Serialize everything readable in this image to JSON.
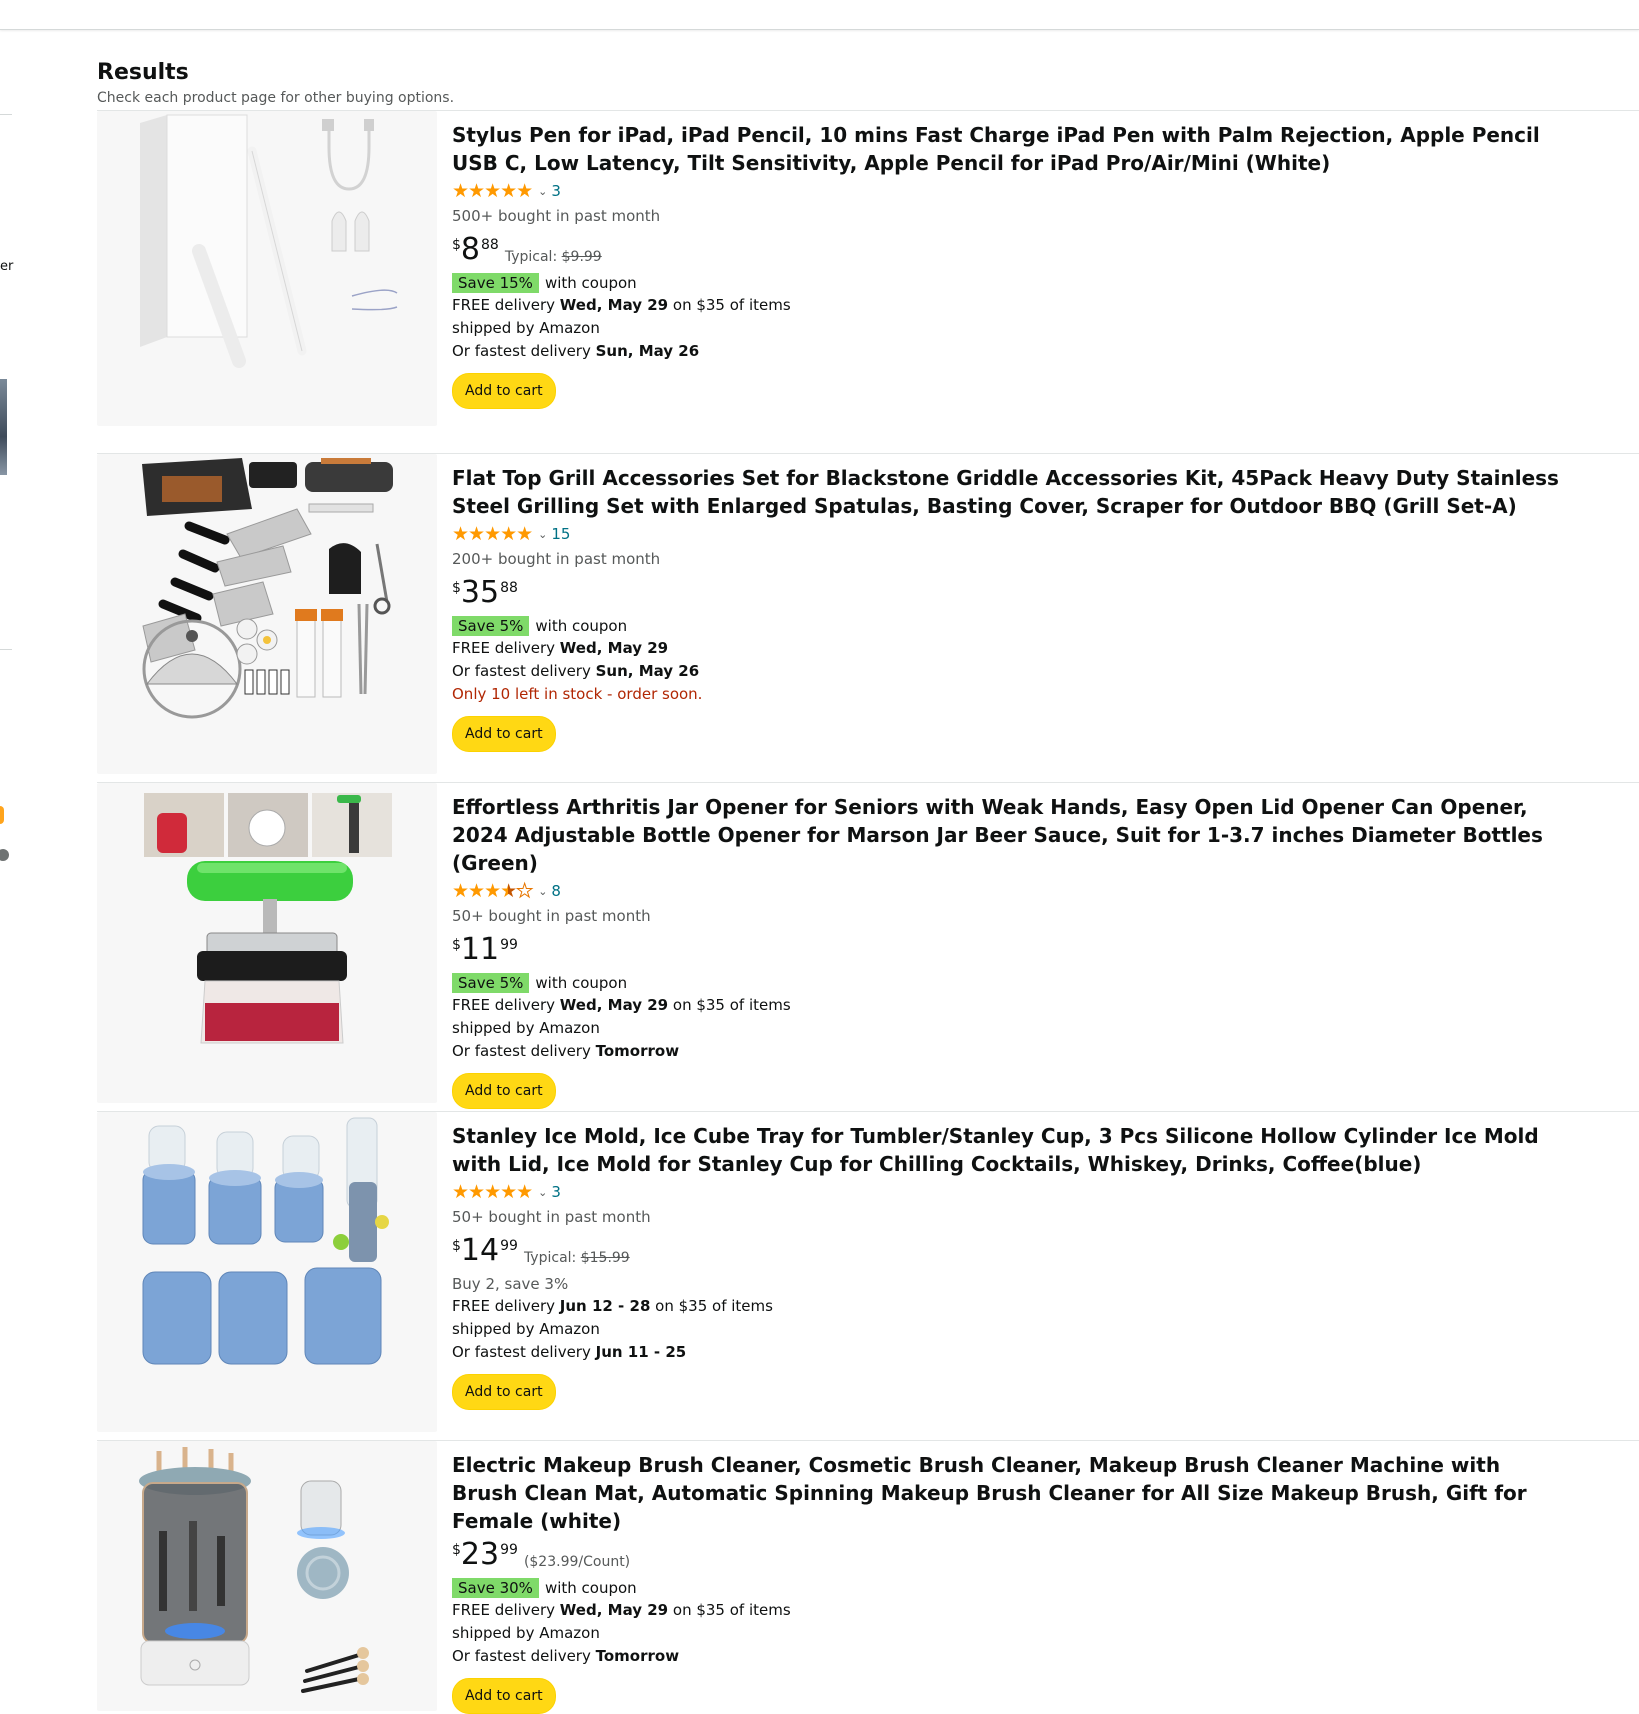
{
  "results": {
    "title": "Results",
    "subtitle": "Check each product page for other buying options."
  },
  "left_strip": {
    "partial_text": "er"
  },
  "colors": {
    "star": "#ff9900",
    "coupon_bg": "#7fda69",
    "button_bg": "#ffd814",
    "stock_red": "#b12704",
    "link": "#007185"
  },
  "products": [
    {
      "title": "Stylus Pen for iPad, iPad Pencil, 10 mins Fast Charge iPad Pen with Palm Rejection, Apple Pencil USB C, Low Latency, Tilt Sensitivity, Apple Pencil for iPad Pro/Air/Mini (White)",
      "stars": 5,
      "rating_count": "3",
      "bought": "500+ bought in past month",
      "price_symbol": "$",
      "price_whole": "8",
      "price_fraction": "88",
      "typical_label": "Typical:",
      "typical_price": "$9.99",
      "coupon": "Save 15%",
      "coupon_suffix": "with coupon",
      "delivery_prefix": "FREE delivery",
      "delivery_date": "Wed, May 29",
      "delivery_suffix": "on $35 of items",
      "shipped": "shipped by Amazon",
      "fastest_prefix": "Or fastest delivery",
      "fastest_date": "Sun, May 26",
      "button": "Add to cart"
    },
    {
      "title": "Flat Top Grill Accessories Set for Blackstone Griddle Accessories Kit, 45Pack Heavy Duty Stainless Steel Grilling Set with Enlarged Spatulas, Basting Cover, Scraper for Outdoor BBQ (Grill Set-A)",
      "stars": 5,
      "rating_count": "15",
      "bought": "200+ bought in past month",
      "price_symbol": "$",
      "price_whole": "35",
      "price_fraction": "88",
      "coupon": "Save 5%",
      "coupon_suffix": "with coupon",
      "delivery_prefix": "FREE delivery",
      "delivery_date": "Wed, May 29",
      "fastest_prefix": "Or fastest delivery",
      "fastest_date": "Sun, May 26",
      "stock": "Only 10 left in stock - order soon.",
      "button": "Add to cart"
    },
    {
      "title": "Effortless Arthritis Jar Opener for Seniors with Weak Hands, Easy Open Lid Opener Can Opener, 2024 Adjustable Bottle Opener for Marson Jar Beer Sauce, Suit for 1-3.7 inches Diameter Bottles (Green)",
      "stars": 3.5,
      "rating_count": "8",
      "bought": "50+ bought in past month",
      "price_symbol": "$",
      "price_whole": "11",
      "price_fraction": "99",
      "coupon": "Save 5%",
      "coupon_suffix": "with coupon",
      "delivery_prefix": "FREE delivery",
      "delivery_date": "Wed, May 29",
      "delivery_suffix": "on $35 of items",
      "shipped": "shipped by Amazon",
      "fastest_prefix": "Or fastest delivery",
      "fastest_date": "Tomorrow",
      "button": "Add to cart"
    },
    {
      "title": "Stanley Ice Mold, Ice Cube Tray for Tumbler/Stanley Cup, 3 Pcs Silicone Hollow Cylinder Ice Mold with Lid, Ice Mold for Stanley Cup for Chilling Cocktails, Whiskey, Drinks, Coffee(blue)",
      "stars": 5,
      "rating_count": "3",
      "bought": "50+ bought in past month",
      "price_symbol": "$",
      "price_whole": "14",
      "price_fraction": "99",
      "typical_label": "Typical:",
      "typical_price": "$15.99",
      "buy2": "Buy 2, save 3%",
      "delivery_prefix": "FREE delivery",
      "delivery_date": "Jun 12 - 28",
      "delivery_suffix": "on $35 of items",
      "shipped": "shipped by Amazon",
      "fastest_prefix": "Or fastest delivery",
      "fastest_date": "Jun 11 - 25",
      "button": "Add to cart"
    },
    {
      "title": "Electric Makeup Brush Cleaner, Cosmetic Brush Cleaner, Makeup Brush Cleaner Machine with Brush Clean Mat, Automatic Spinning Makeup Brush Cleaner for All Size Makeup Brush, Gift for Female (white)",
      "price_symbol": "$",
      "price_whole": "23",
      "price_fraction": "99",
      "unit_price": "($23.99/Count)",
      "coupon": "Save 30%",
      "coupon_suffix": "with coupon",
      "delivery_prefix": "FREE delivery",
      "delivery_date": "Wed, May 29",
      "delivery_suffix": "on $35 of items",
      "shipped": "shipped by Amazon",
      "fastest_prefix": "Or fastest delivery",
      "fastest_date": "Tomorrow",
      "button": "Add to cart"
    }
  ]
}
